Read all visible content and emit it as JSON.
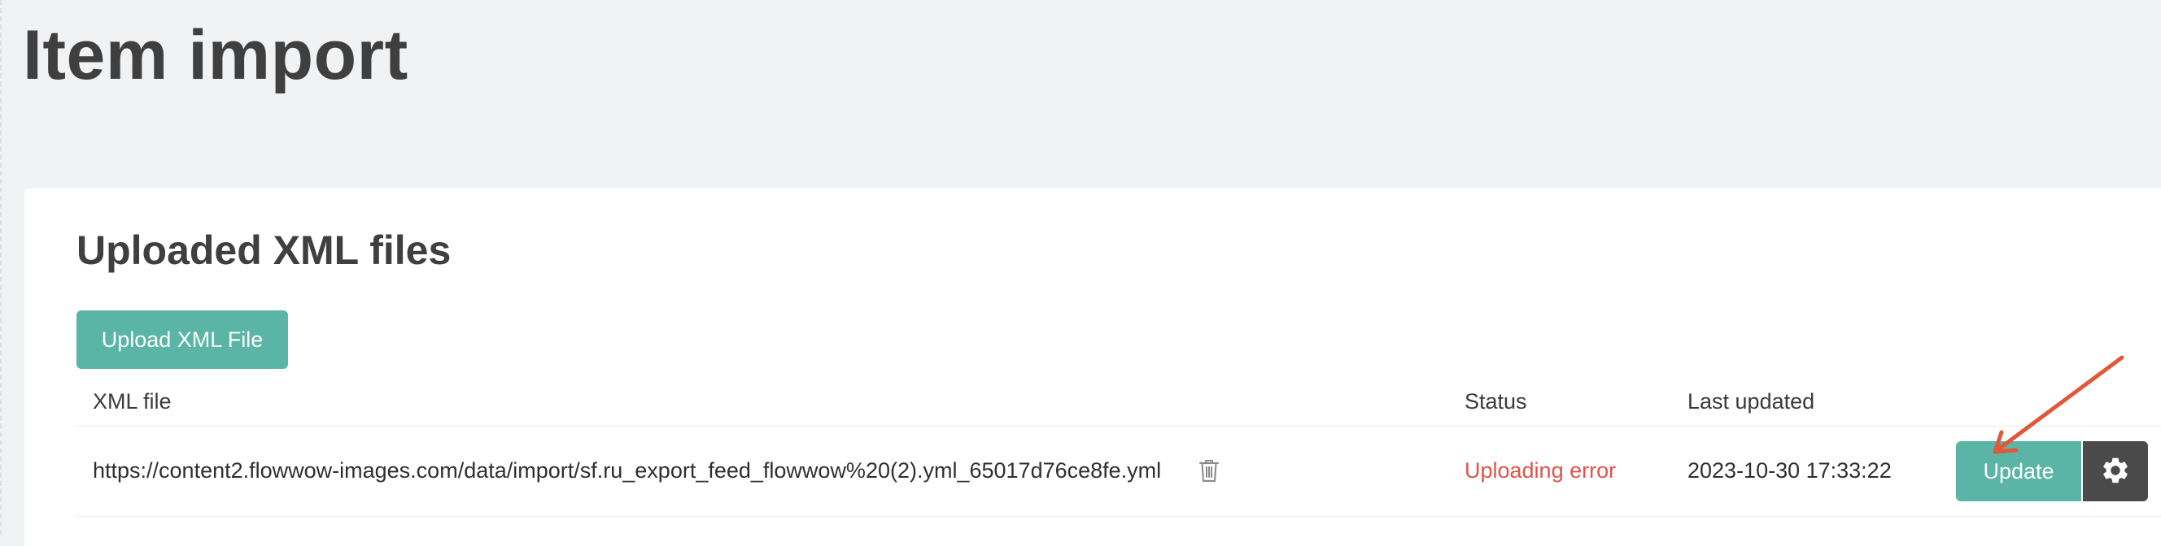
{
  "page": {
    "title": "Item import"
  },
  "section": {
    "title": "Uploaded XML files",
    "upload_button_label": "Upload XML File"
  },
  "table": {
    "headers": {
      "file": "XML file",
      "status": "Status",
      "last_updated": "Last updated"
    },
    "rows": [
      {
        "file_url": "https://content2.flowwow-images.com/data/import/sf.ru_export_feed_flowwow%20(2).yml_65017d76ce8fe.yml",
        "status": "Uploading error",
        "last_updated": "2023-10-30 17:33:22",
        "update_label": "Update",
        "delete_icon": "trash-icon",
        "settings_icon": "gear-icon"
      }
    ]
  },
  "colors": {
    "background": "#f1f2f4",
    "panel": "#ffffff",
    "accent": "#5bb5a6",
    "dark_button": "#4a4a4a",
    "error": "#e0534a",
    "annotation_arrow": "#e0583a"
  }
}
